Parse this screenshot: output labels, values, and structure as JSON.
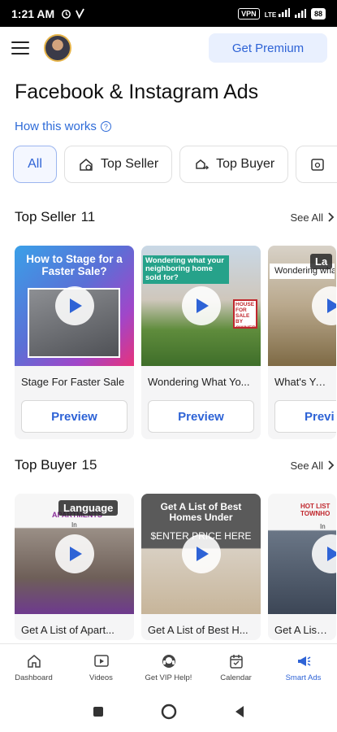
{
  "status": {
    "time": "1:21 AM",
    "icons": [
      "alarm-icon",
      "check-icon"
    ],
    "right_badges": [
      "VPN",
      "LTE",
      "88"
    ]
  },
  "appbar": {
    "premium_label": "Get Premium"
  },
  "page": {
    "title": "Facebook & Instagram Ads",
    "how_label": "How this works"
  },
  "chips": [
    {
      "label": "All"
    },
    {
      "label": "Top Seller",
      "icon": "home-tag-icon"
    },
    {
      "label": "Top Buyer",
      "icon": "buyer-icon"
    },
    {
      "label": "",
      "icon": "calendar-icon"
    }
  ],
  "top_seller": {
    "title": "Top Seller",
    "count": "11",
    "see_all": "See All",
    "cards": [
      {
        "title": "Stage For Faster Sale",
        "overlay": "How to Stage for a Faster Sale?",
        "button": "Preview"
      },
      {
        "title": "Wondering What Yo...",
        "overlay": "Wondering what your neighboring home sold for?",
        "sign": "HOUSE FOR SALE BY OWNER",
        "button": "Preview"
      },
      {
        "title": "What's Your",
        "overlay": "Wondering wha home w",
        "lang": "La",
        "button": "Previ"
      }
    ]
  },
  "top_buyer": {
    "title": "Top Buyer",
    "count": "15",
    "see_all": "See All",
    "cards": [
      {
        "title": "Get A List of Apart...",
        "overlay": "APARTMENTS",
        "sub": "In",
        "lang": "Language"
      },
      {
        "title": "Get A List of Best H...",
        "overlay": "Get A List of Best Homes Under",
        "sub": "$ENTER PRICE HERE"
      },
      {
        "title": "Get A List of",
        "overlay": "HOT LIST TOWNHO",
        "sub": "In"
      }
    ]
  },
  "bottom_nav": [
    {
      "label": "Dashboard",
      "icon": "home-icon"
    },
    {
      "label": "Videos",
      "icon": "video-icon"
    },
    {
      "label": "Get VIP Help!",
      "icon": "headset-icon"
    },
    {
      "label": "Calendar",
      "icon": "calendar-icon"
    },
    {
      "label": "Smart Ads",
      "icon": "megaphone-icon",
      "active": true
    }
  ],
  "colors": {
    "accent": "#2e63d6",
    "premium_bg": "#e9f0fe"
  }
}
